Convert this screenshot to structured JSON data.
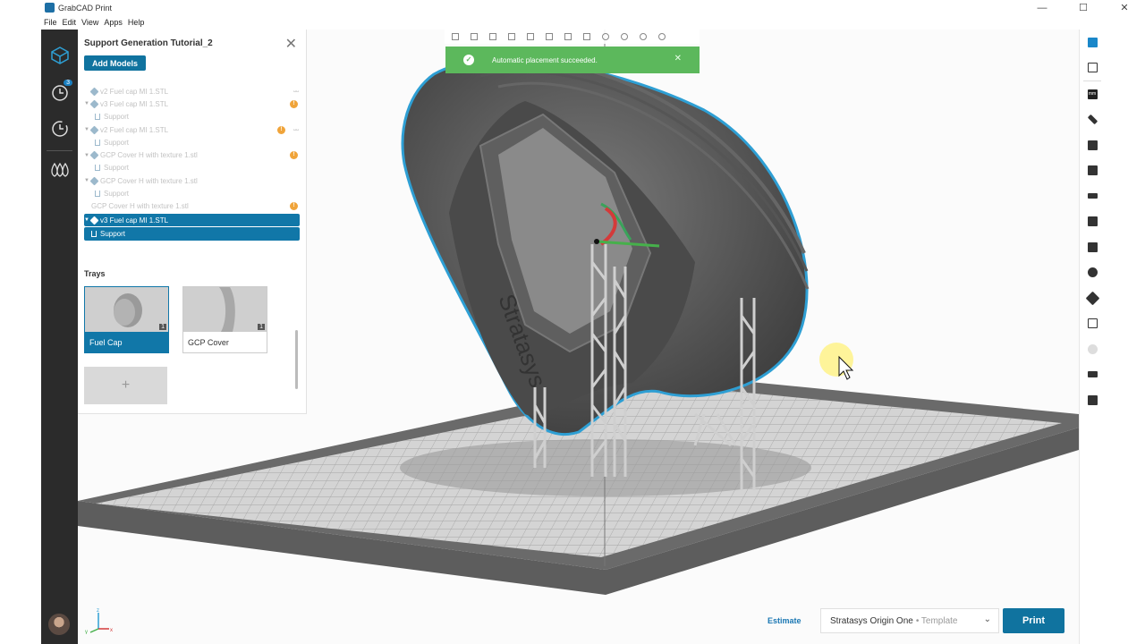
{
  "window": {
    "title": "GrabCAD Print",
    "controls": [
      "—",
      "☐",
      "✕"
    ]
  },
  "menu": [
    "File",
    "Edit",
    "View",
    "Apps",
    "Help"
  ],
  "rail": {
    "recent_badge": "3"
  },
  "panel": {
    "title": "Support Generation Tutorial_2",
    "add_models_label": "Add Models",
    "tree": [
      {
        "label": "v2 Fuel cap MI 1.STL",
        "level": 0,
        "kind": "model",
        "warn": false,
        "eye": true
      },
      {
        "label": "v3 Fuel cap MI 1.STL",
        "level": 0,
        "kind": "model",
        "warn": true,
        "eye": false
      },
      {
        "label": "Support",
        "level": 1,
        "kind": "support",
        "warn": false,
        "eye": false
      },
      {
        "label": "v2 Fuel cap MI 1.STL",
        "level": 0,
        "kind": "model",
        "warn": true,
        "eye": true
      },
      {
        "label": "Support",
        "level": 1,
        "kind": "support",
        "warn": false,
        "eye": false
      },
      {
        "label": "GCP Cover H with texture 1.stl",
        "level": 0,
        "kind": "model",
        "warn": true,
        "eye": false
      },
      {
        "label": "Support",
        "level": 1,
        "kind": "support",
        "warn": false,
        "eye": false
      },
      {
        "label": "GCP Cover H with texture 1.stl",
        "level": 0,
        "kind": "model",
        "warn": false,
        "eye": false
      },
      {
        "label": "Support",
        "level": 1,
        "kind": "support",
        "warn": false,
        "eye": false
      },
      {
        "label": "GCP Cover H with texture 1.stl",
        "level": 0,
        "kind": "model",
        "warn": true,
        "eye": false
      }
    ],
    "selected_model": "v3 Fuel cap MI 1.STL",
    "selected_support": "Support",
    "trays_label": "Trays",
    "trays": [
      {
        "name": "Fuel Cap",
        "count": "1",
        "active": true
      },
      {
        "name": "GCP Cover",
        "count": "1",
        "active": false
      }
    ],
    "add_tray": "+"
  },
  "toast": {
    "message": "Automatic placement succeeded.",
    "close": "✕",
    "check": "✓"
  },
  "right_tools": [
    "cube-blue",
    "view-cube",
    "mm",
    "ruler",
    "layers",
    "supports",
    "align",
    "paint",
    "arrange",
    "rotate",
    "move",
    "scale",
    "disabled",
    "slices",
    "package"
  ],
  "mm_label": "mm",
  "bottom": {
    "estimate": "Estimate",
    "printer": "Stratasys Origin One",
    "template": "• Template",
    "chevron": "⌄",
    "print_label": "Print"
  },
  "axes": {
    "x": "x",
    "y": "y",
    "z": "z"
  },
  "colors": {
    "accent": "#10739f",
    "toast": "#5cb85c",
    "warn": "#f0a43a",
    "rail": "#2b2b2b"
  }
}
